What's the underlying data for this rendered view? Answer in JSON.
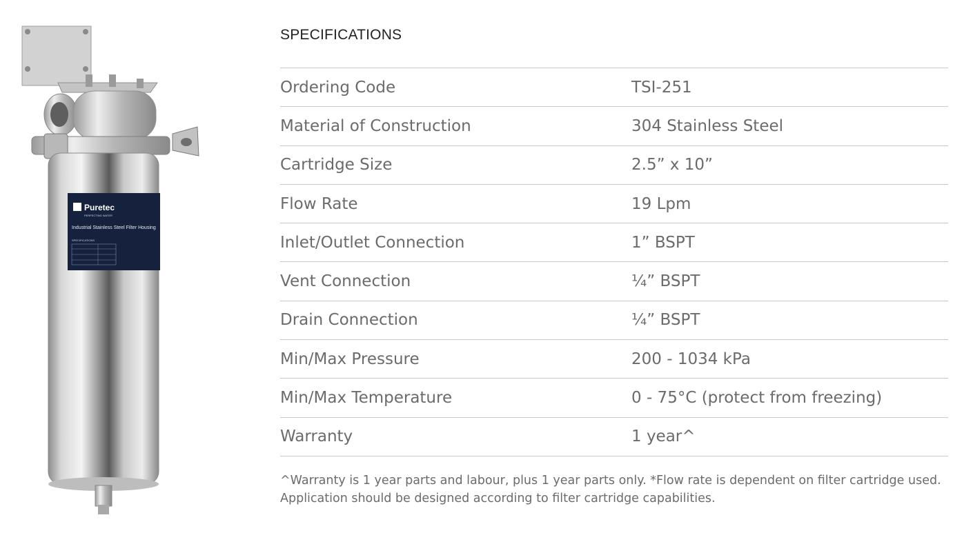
{
  "product": {
    "image_alt": "Stainless steel filter housing",
    "label_brand": "Puretec",
    "label_tagline": "PERFECTING WATER",
    "label_title": "Industrial Stainless Steel Filter Housing",
    "label_specs_heading": "SPECIFICATIONS"
  },
  "specs": {
    "heading": "SPECIFICATIONS",
    "rows": [
      {
        "label": "Ordering Code",
        "value": "TSI-251"
      },
      {
        "label": "Material of Construction",
        "value": "304 Stainless Steel"
      },
      {
        "label": "Cartridge Size",
        "value": "2.5” x 10”"
      },
      {
        "label": "Flow Rate",
        "value": "19 Lpm"
      },
      {
        "label": "Inlet/Outlet Connection",
        "value": "1” BSPT"
      },
      {
        "label": "Vent Connection",
        "value": "¼” BSPT"
      },
      {
        "label": "Drain Connection",
        "value": "¼” BSPT"
      },
      {
        "label": "Min/Max Pressure",
        "value": "200 - 1034 kPa"
      },
      {
        "label": "Min/Max Temperature",
        "value": "0 - 75°C (protect from freezing)"
      },
      {
        "label": "Warranty",
        "value": "1 year^"
      }
    ],
    "note_line1": "^Warranty is 1 year parts and labour, plus 1 year parts only. *Flow rate is dependent on filter cartridge used.",
    "note_line2": "Application should be designed according to filter cartridge capabilities."
  },
  "colors": {
    "text": "#6b6b6b",
    "heading": "#222222",
    "divider": "#c9c9c9",
    "label_navy": "#16213e"
  }
}
